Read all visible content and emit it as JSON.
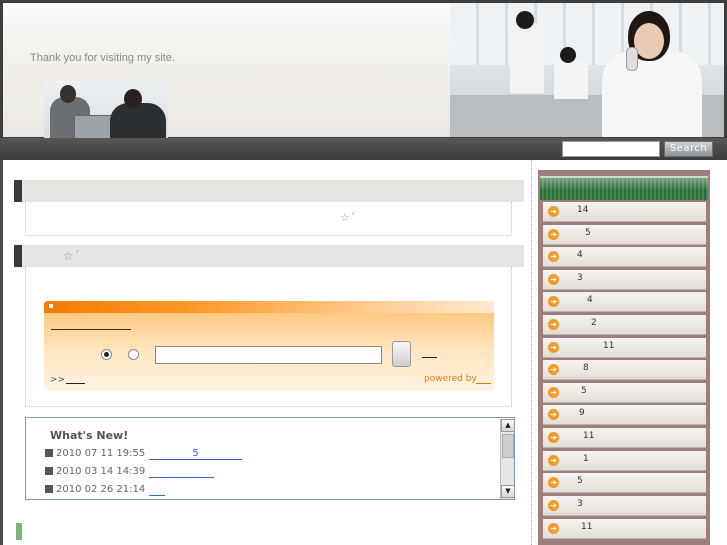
{
  "header": {
    "tagline": "Thank you for visiting my site."
  },
  "search": {
    "placeholder": "",
    "button_label": "Search"
  },
  "main": {
    "section1": {
      "star_text": "☆´"
    },
    "section2": {
      "star_text": "☆´"
    },
    "widget": {
      "more_label": ">>",
      "powered_label": "powered by"
    },
    "news": {
      "title": "What's New!",
      "items": [
        {
          "date": "2010 07 11  19:55",
          "link_text": "5"
        },
        {
          "date": "2010 03 14  14:39",
          "link_text": ""
        },
        {
          "date": "2010 02 26  21:14",
          "link_text": ""
        }
      ]
    }
  },
  "sidebar": {
    "items": [
      {
        "label": "14"
      },
      {
        "label": "5"
      },
      {
        "label": "4"
      },
      {
        "label": "3"
      },
      {
        "label": "4"
      },
      {
        "label": "2"
      },
      {
        "label": "11"
      },
      {
        "label": "8"
      },
      {
        "label": "5"
      },
      {
        "label": "9"
      },
      {
        "label": "11"
      },
      {
        "label": "1"
      },
      {
        "label": "5"
      },
      {
        "label": "3"
      },
      {
        "label": "11"
      }
    ]
  },
  "colors": {
    "accent_orange": "#f39a2a",
    "sidebar_header_green": "#3f8a4b",
    "news_border": "#7c9bb8",
    "link_blue": "#3366cc"
  },
  "icons": {
    "sidebar_bullet": "arrow-right-circle-icon",
    "news_bullet": "square-bullet-icon"
  }
}
